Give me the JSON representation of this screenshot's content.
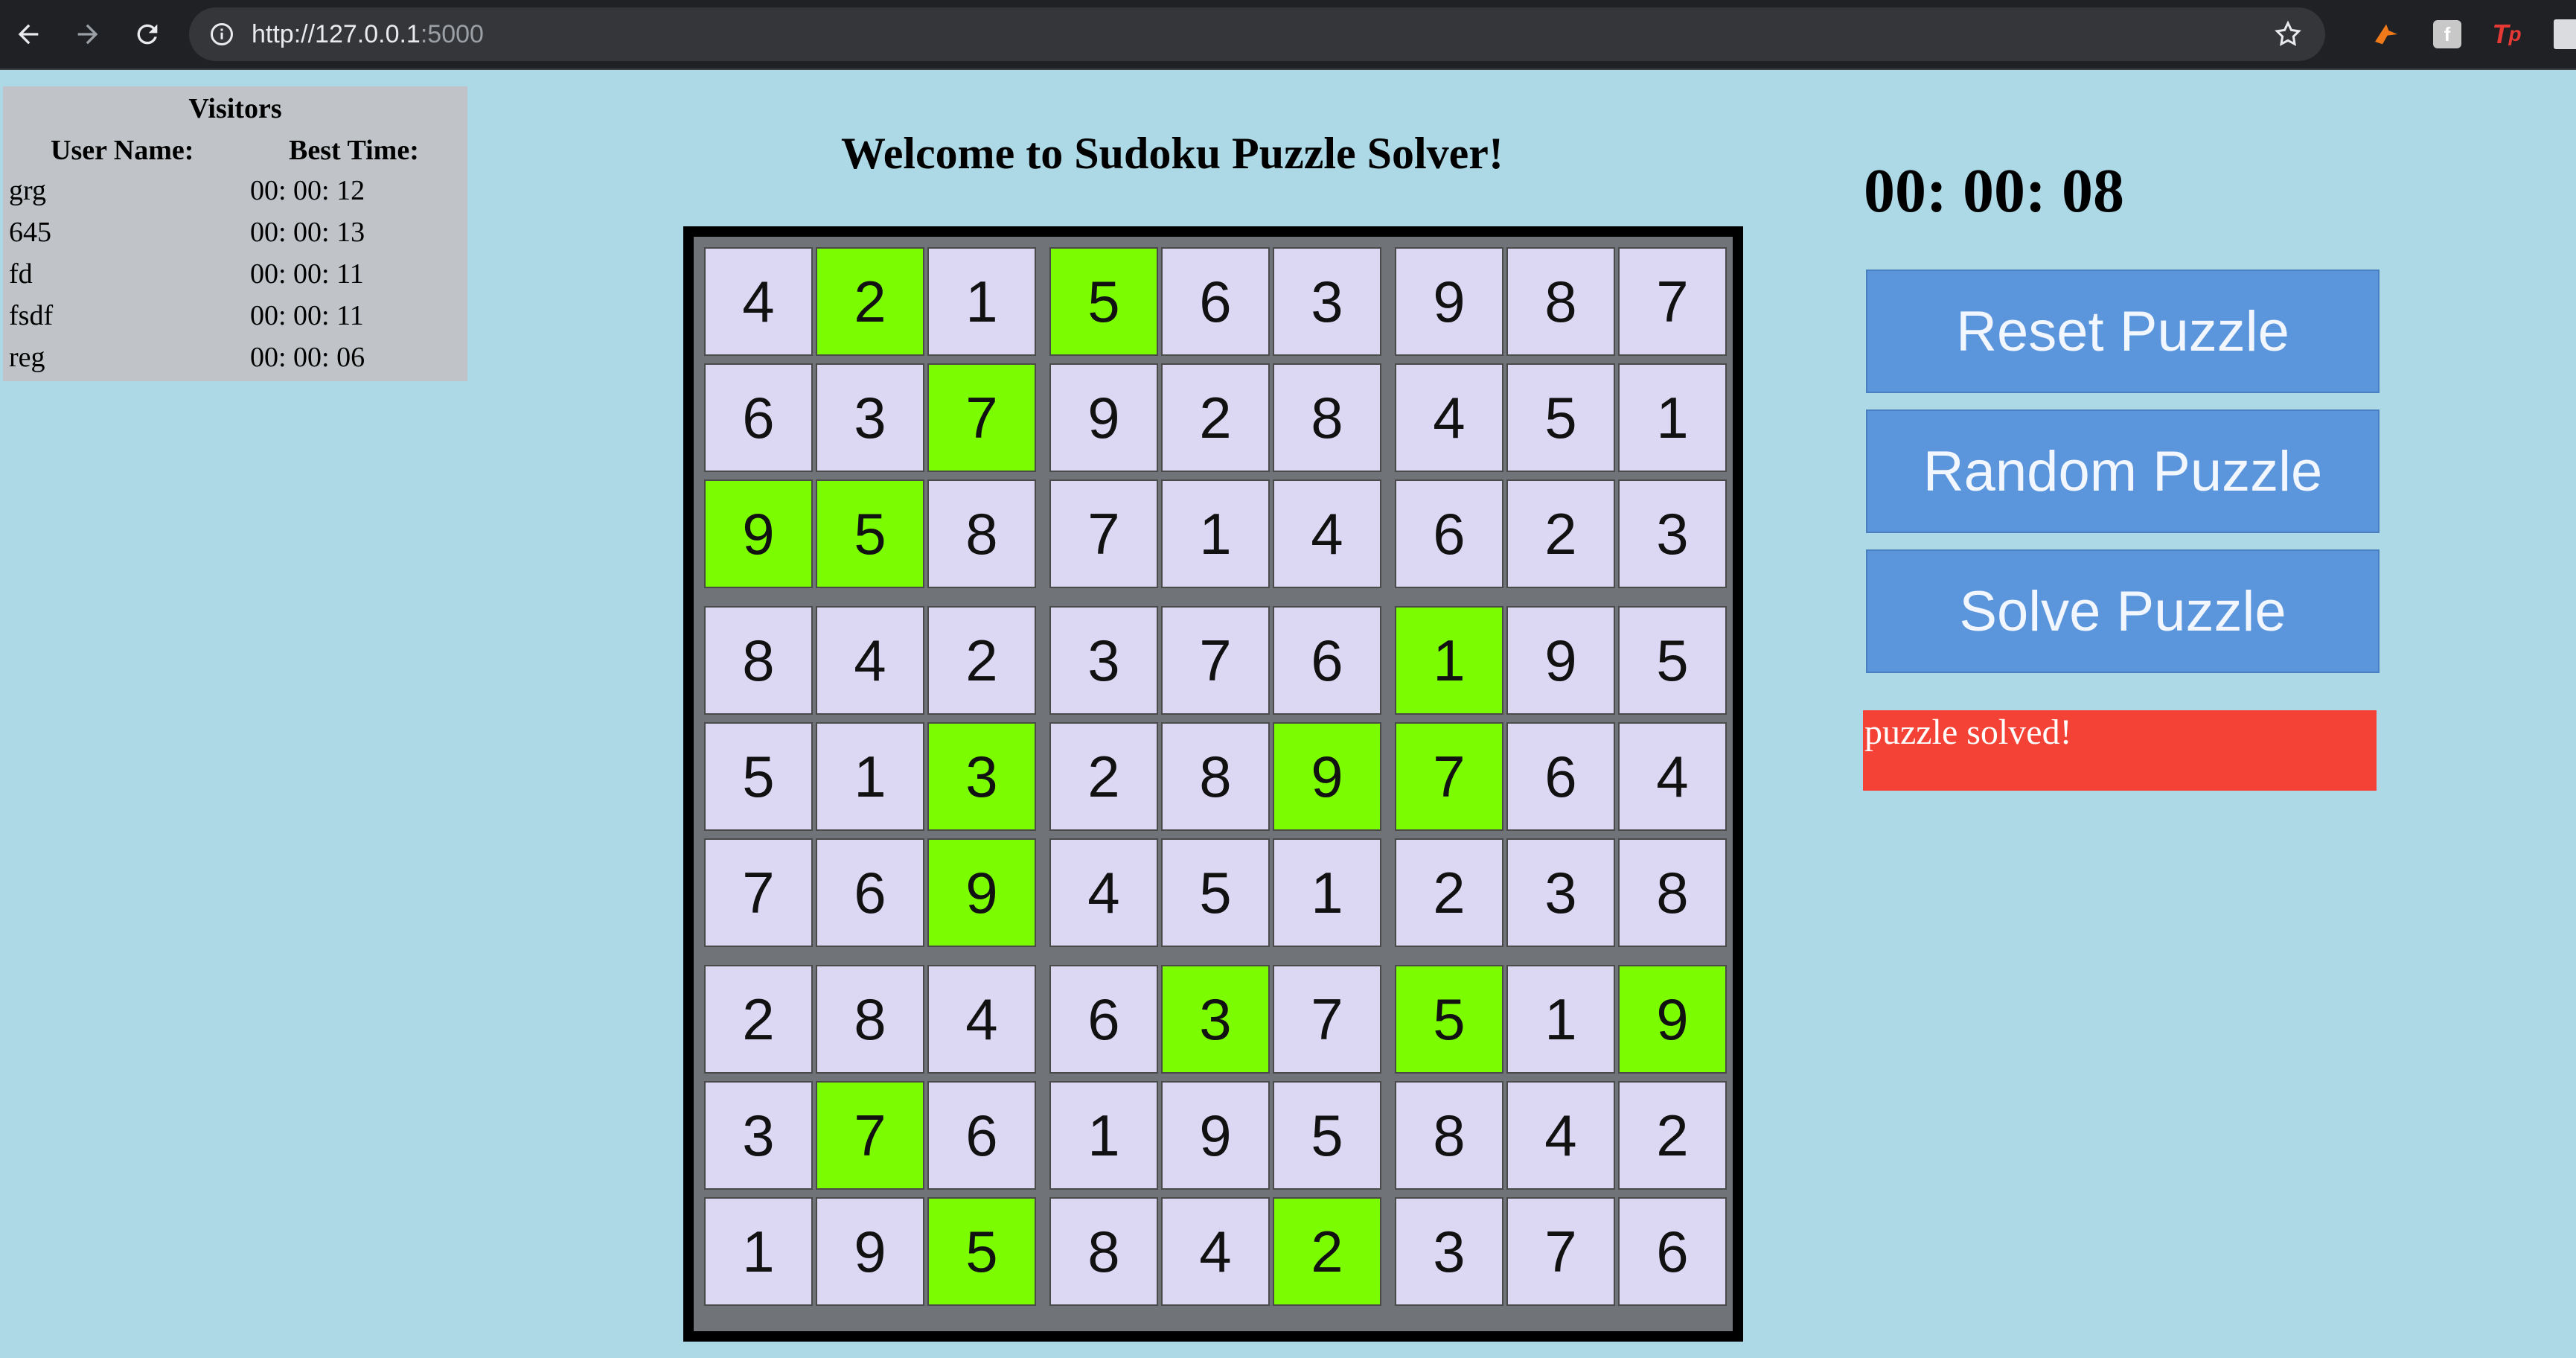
{
  "browser": {
    "url_host": "http://127.0.0.1",
    "url_port": ":5000"
  },
  "visitors": {
    "title": "Visitors",
    "col_user": "User Name:",
    "col_time": "Best Time:",
    "rows": [
      {
        "name": "grg",
        "time": "00: 00: 12"
      },
      {
        "name": "645",
        "time": "00: 00: 13"
      },
      {
        "name": "fd",
        "time": "00: 00: 11"
      },
      {
        "name": "fsdf",
        "time": "00: 00: 11"
      },
      {
        "name": "reg",
        "time": "00: 00: 06"
      }
    ]
  },
  "heading": "Welcome to Sudoku Puzzle Solver!",
  "timer": "00: 00: 08",
  "buttons": {
    "reset": "Reset Puzzle",
    "random": "Random Puzzle",
    "solve": "Solve Puzzle"
  },
  "status": "puzzle solved!",
  "colors": {
    "background": "#add8e6",
    "cell": "#dcd8f4",
    "cell_highlight": "#7cfc00",
    "button": "#5b96dd",
    "status": "#f44336"
  },
  "sudoku": {
    "grid": [
      [
        4,
        2,
        1,
        5,
        6,
        3,
        9,
        8,
        7
      ],
      [
        6,
        3,
        7,
        9,
        2,
        8,
        4,
        5,
        1
      ],
      [
        9,
        5,
        8,
        7,
        1,
        4,
        6,
        2,
        3
      ],
      [
        8,
        4,
        2,
        3,
        7,
        6,
        1,
        9,
        5
      ],
      [
        5,
        1,
        3,
        2,
        8,
        9,
        7,
        6,
        4
      ],
      [
        7,
        6,
        9,
        4,
        5,
        1,
        2,
        3,
        8
      ],
      [
        2,
        8,
        4,
        6,
        3,
        7,
        5,
        1,
        9
      ],
      [
        3,
        7,
        6,
        1,
        9,
        5,
        8,
        4,
        2
      ],
      [
        1,
        9,
        5,
        8,
        4,
        2,
        3,
        7,
        6
      ]
    ],
    "highlighted": [
      [
        0,
        1
      ],
      [
        0,
        3
      ],
      [
        1,
        2
      ],
      [
        2,
        0
      ],
      [
        2,
        1
      ],
      [
        3,
        6
      ],
      [
        4,
        2
      ],
      [
        4,
        5
      ],
      [
        4,
        6
      ],
      [
        5,
        2
      ],
      [
        6,
        4
      ],
      [
        6,
        6
      ],
      [
        6,
        8
      ],
      [
        7,
        1
      ],
      [
        8,
        2
      ],
      [
        8,
        5
      ]
    ]
  }
}
